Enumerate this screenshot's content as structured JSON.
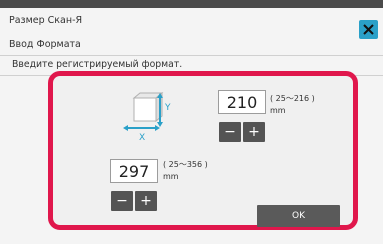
{
  "header": {
    "title": "Размер Скан-Я",
    "subtitle": "Ввод Формата"
  },
  "instruction": "Введите регистрируемый формат.",
  "paper_icon": {
    "name": "paper-size-icon",
    "y_label": "Y",
    "x_label": "X"
  },
  "y_field": {
    "value": "210",
    "range": "( 25〜216 )",
    "unit": "mm",
    "minus_label": "−",
    "plus_label": "+"
  },
  "x_field": {
    "value": "297",
    "range": "( 25〜356 )",
    "unit": "mm",
    "minus_label": "−",
    "plus_label": "+"
  },
  "ok_label": "OK",
  "colors": {
    "accent": "#2aa0c8",
    "highlight": "#e0174c",
    "button": "#545454"
  }
}
